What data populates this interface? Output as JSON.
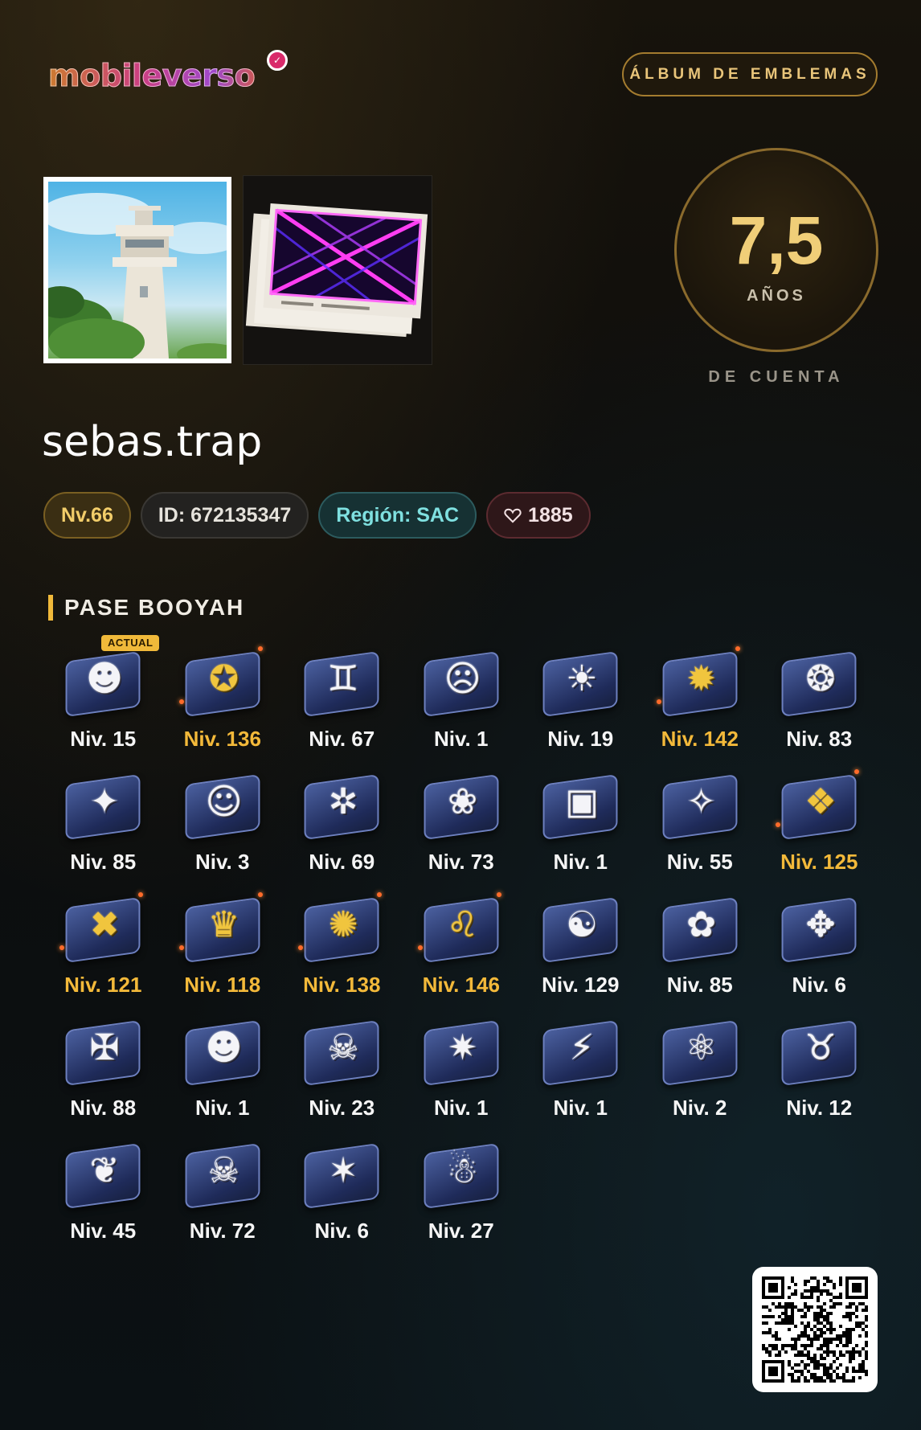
{
  "brand": {
    "name": "mobileverso",
    "badge_icon": "heart-chevron-icon"
  },
  "header": {
    "album_button": "ÁLBUM DE EMBLEMAS"
  },
  "account_age": {
    "value": "7,5",
    "unit": "AÑOS",
    "caption": "DE CUENTA"
  },
  "profile": {
    "username": "sebas.trap",
    "level": "Nv.66",
    "id": "ID: 672135347",
    "region": "Región: SAC",
    "likes": "1885"
  },
  "section": {
    "title": "PASE BOOYAH"
  },
  "current_tag": "ACTUAL",
  "emblems": [
    {
      "level": "Niv. 15",
      "icon": "grinning-apple-icon",
      "gold": false
    },
    {
      "level": "Niv. 136",
      "icon": "wolf-crest-icon",
      "gold": true
    },
    {
      "level": "Niv. 67",
      "icon": "gemini-icon",
      "gold": false
    },
    {
      "level": "Niv. 1",
      "icon": "masked-face-icon",
      "gold": false
    },
    {
      "level": "Niv. 19",
      "icon": "sun-sunglasses-icon",
      "gold": false
    },
    {
      "level": "Niv. 142",
      "icon": "spiked-skull-icon",
      "gold": true
    },
    {
      "level": "Niv. 83",
      "icon": "swirl-icon",
      "gold": false
    },
    {
      "level": "Niv. 85",
      "icon": "wolf-head-icon",
      "gold": false
    },
    {
      "level": "Niv. 3",
      "icon": "cartoon-face-icon",
      "gold": false
    },
    {
      "level": "Niv. 69",
      "icon": "bee-icon",
      "gold": false
    },
    {
      "level": "Niv. 73",
      "icon": "clown-icon",
      "gold": false
    },
    {
      "level": "Niv. 1",
      "icon": "box-robot-icon",
      "gold": false
    },
    {
      "level": "Niv. 55",
      "icon": "shattered-card-icon",
      "gold": false
    },
    {
      "level": "Niv. 125",
      "icon": "tiger-icon",
      "gold": true
    },
    {
      "level": "Niv. 121",
      "icon": "x-eyes-face-icon",
      "gold": true
    },
    {
      "level": "Niv. 118",
      "icon": "ox-crown-icon",
      "gold": true
    },
    {
      "level": "Niv. 138",
      "icon": "octopus-icon",
      "gold": true
    },
    {
      "level": "Niv. 146",
      "icon": "leo-icon",
      "gold": true
    },
    {
      "level": "Niv. 129",
      "icon": "cat-glasses-icon",
      "gold": false
    },
    {
      "level": "Niv. 85",
      "icon": "leaf-blades-icon",
      "gold": false
    },
    {
      "level": "Niv. 6",
      "icon": "wolf-howl-icon",
      "gold": false
    },
    {
      "level": "Niv. 88",
      "icon": "star-cross-icon",
      "gold": false
    },
    {
      "level": "Niv. 1",
      "icon": "frog-face-icon",
      "gold": false
    },
    {
      "level": "Niv. 23",
      "icon": "dragon-skull-icon",
      "gold": false
    },
    {
      "level": "Niv. 1",
      "icon": "spiky-ball-icon",
      "gold": false
    },
    {
      "level": "Niv. 1",
      "icon": "claw-slash-icon",
      "gold": false
    },
    {
      "level": "Niv. 2",
      "icon": "atom-ring-icon",
      "gold": false
    },
    {
      "level": "Niv. 12",
      "icon": "horned-skull-icon",
      "gold": false
    },
    {
      "level": "Niv. 45",
      "icon": "phoenix-icon",
      "gold": false
    },
    {
      "level": "Niv. 72",
      "icon": "demon-mask-icon",
      "gold": false
    },
    {
      "level": "Niv. 6",
      "icon": "dragon-head-icon",
      "gold": false
    },
    {
      "level": "Niv. 27",
      "icon": "headphone-bomb-icon",
      "gold": false
    }
  ],
  "colors": {
    "gold": "#f3b93a",
    "accent": "#f0ce78",
    "region": "#7fe0e0"
  }
}
